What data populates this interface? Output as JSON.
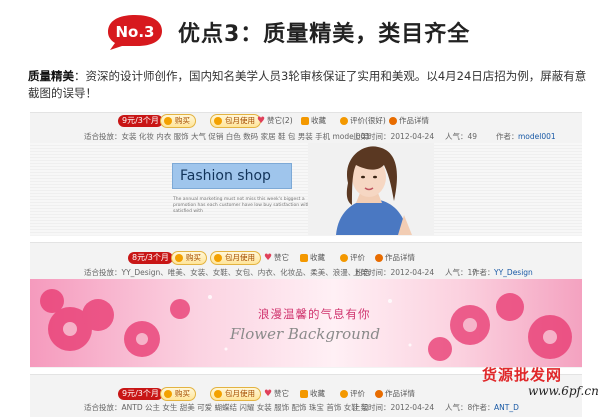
{
  "header": {
    "badge_text": "No.3",
    "headline": "优点3：质量精美，类目齐全"
  },
  "description": {
    "label": "质量精美",
    "text": "：资深的设计师创作，国内知名美学人员3轮审核保证了实用和美观。以4月24日店招为例，屏蔽有意截图的误导！"
  },
  "templates": [
    {
      "price": "9元/3个月",
      "buy_label": "购买",
      "monthly_label": "包月使用",
      "like_label": "赞它(2)",
      "fav_label": "收藏",
      "eval_label": "评价(很好)",
      "detail_label": "作品详情",
      "meta": {
        "tags": "适合投放：女装 化妆 内衣 服饰 大气 促销 白色 数码 家居 鞋 包 男装 手机 model001",
        "date": "上架时间：2012-04-24",
        "popularity": "人气：49",
        "author_prefix": "作者：",
        "author": "model001"
      },
      "banner": {
        "title": "Fashion shop",
        "small_text": "The annual marketing must not miss this week's biggest a promotion has each customer have low buy satisfaction with the satisfied with"
      }
    },
    {
      "price": "8元/3个月",
      "buy_label": "购买",
      "monthly_label": "包月使用",
      "like_label": "赞它",
      "fav_label": "收藏",
      "eval_label": "评价",
      "detail_label": "作品详情",
      "meta": {
        "tags": "适合投放：YY_Design、唯美、女装、女鞋、女包、内衣、化妆品、柔美、浪漫、粉色",
        "date": "上架时间：2012-04-24",
        "popularity": "人气：17",
        "author_prefix": "作者：",
        "author": "YY_Design"
      },
      "banner": {
        "title_cn": "浪漫温馨的气息有你",
        "title_en": "Flower Background"
      }
    },
    {
      "price": "9元/3个月",
      "buy_label": "购买",
      "monthly_label": "包月使用",
      "like_label": "赞它",
      "fav_label": "收藏",
      "eval_label": "评价",
      "detail_label": "作品详情",
      "meta": {
        "tags": "适合投放：ANTD 公主 女生 甜美 可爱 蝴蝶结 闪耀 女装 服饰 配饰 珠宝 首饰 女鞋 包",
        "date": "上架时间：2012-04-24",
        "popularity": "人气：8",
        "author_prefix": "作者：",
        "author": "ANT_D"
      }
    }
  ],
  "watermark": {
    "text": "货源批发网",
    "url": "www.6pf.cn"
  },
  "colors": {
    "badge_red": "#d7191e",
    "price_red": "#c81616",
    "button_orange": "#f3a100",
    "author_blue": "#1a5aa6",
    "fashion_blue": "#9fc5ec",
    "flower_pink": "#f59abd"
  }
}
